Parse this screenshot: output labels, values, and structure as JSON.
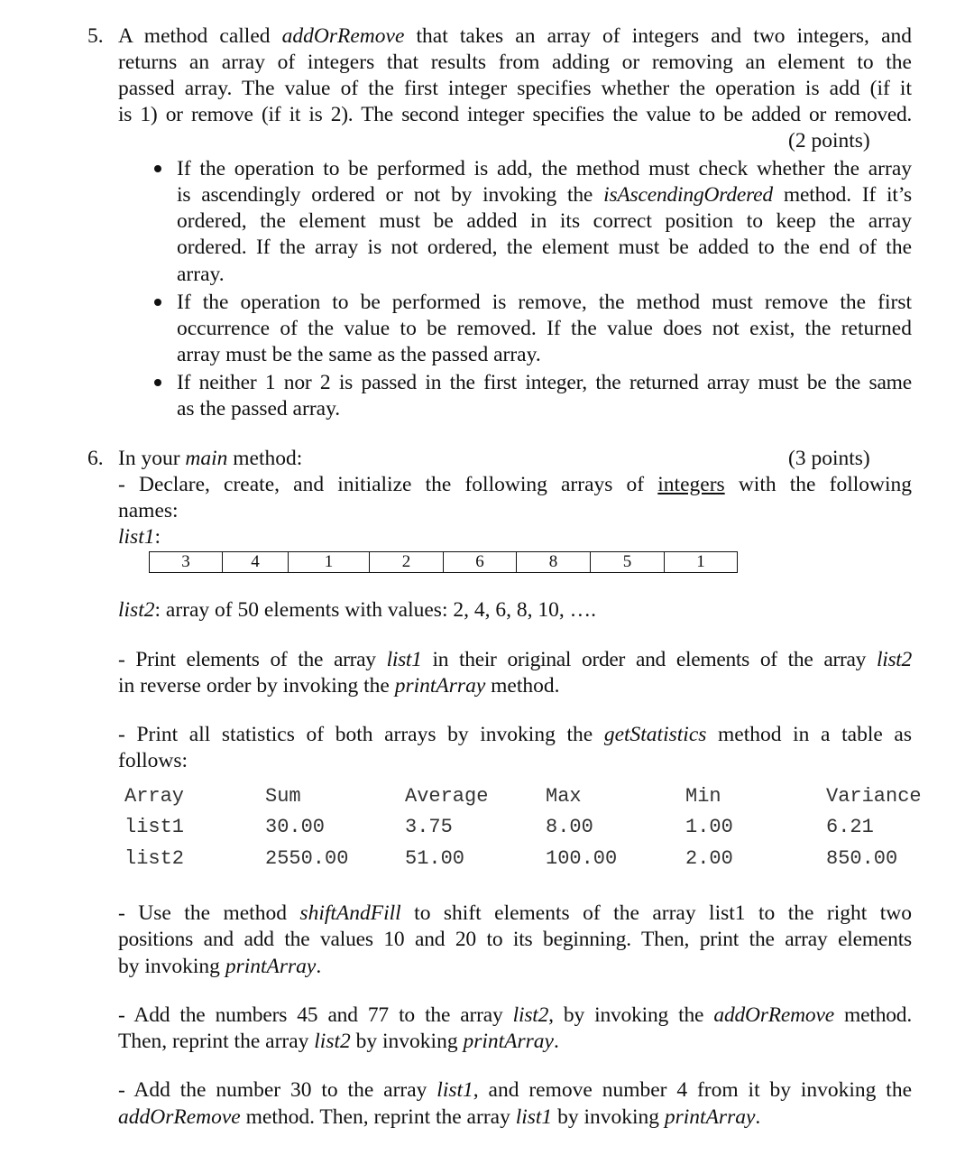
{
  "q5": {
    "number": "5.",
    "lines": [
      [
        "A method called ",
        "addOrRemove",
        " that takes an array of integers and two integers, and"
      ],
      "returns an array of integers that results from adding or removing an element to the",
      "passed array. The value of the first integer specifies whether the operation is add (if it",
      "is 1) or remove (if it is 2). The second integer specifies the value to be added or removed."
    ],
    "l1a": "A method called ",
    "l1b": "addOrRemove",
    "l1c": " that takes an array of integers and two integers, and",
    "l2": "returns an array of integers that results from adding or removing an element to the",
    "l3": "passed array. The value of the first integer specifies whether the operation is add (if it",
    "l4": "is 1) or remove (if it is 2). The second integer specifies the value to be added or removed.",
    "points": "(2 points)",
    "bullets": {
      "b1": {
        "l1": "If the operation to be performed is add, the method must check whether the array",
        "l2a": "is ascendingly ordered or not by invoking the ",
        "l2b": "isAscendingOrdered",
        "l2c": " method. If it’s",
        "l3": "ordered, the element must be added in its correct position to keep the array",
        "l4": "ordered. If the array is not ordered, the element must be added to the end of the",
        "l5": "array."
      },
      "b2": {
        "l1": "If the operation to be performed is remove, the method must remove the first",
        "l2": "occurrence of the value to be removed. If the value does not exist, the returned",
        "l3": "array must be the same as the passed array."
      },
      "b3": {
        "l1": "If neither 1 nor 2 is passed in the first integer, the returned array must be the same",
        "l2": "as the passed array."
      }
    }
  },
  "q6": {
    "number": "6.",
    "intro_a": "In your ",
    "intro_b": "main",
    "intro_c": " method:",
    "points": "(3 points)",
    "declare_a": "- Declare, create, and initialize the following arrays of ",
    "declare_b": "integers",
    "declare_c": " with the following",
    "declare_d": "names:",
    "list1_label": "list1",
    "list1_colon": ":",
    "list1_values": [
      "3",
      "4",
      "1",
      "2",
      "6",
      "8",
      "5",
      "1"
    ],
    "list2_label": "list2",
    "list2_text": ": array of 50 elements with values: 2, 4, 6, 8, 10, ….",
    "print": {
      "l1a": "- Print elements of the array ",
      "l1b": "list1",
      "l1c": " in their original order and elements of the array ",
      "l1d": "list2",
      "l2a": "in reverse order by invoking the ",
      "l2b": "printArray",
      "l2c": " method."
    },
    "stats": {
      "l1a": "- Print all statistics of both arrays by invoking the ",
      "l1b": "getStatistics",
      "l1c": " method in a table as",
      "l2": "follows:"
    },
    "stats_table": {
      "headers": [
        "Array",
        "Sum",
        "Average",
        "Max",
        "Min",
        "Variance"
      ],
      "rows": [
        [
          "list1",
          "30.00",
          "3.75",
          "8.00",
          "1.00",
          "6.21"
        ],
        [
          "list2",
          "2550.00",
          "51.00",
          "100.00",
          "2.00",
          "850.00"
        ]
      ]
    },
    "shift": {
      "l1a": "- Use the method ",
      "l1b": "shiftAndFill",
      "l1c": " to shift elements of the array list1 to the right two",
      "l2": "positions and add the values 10 and 20 to its beginning. Then, print the array elements",
      "l3a": "by invoking ",
      "l3b": "printArray",
      "l3c": "."
    },
    "add45": {
      "l1a": "- Add the numbers 45 and 77 to the array ",
      "l1b": "list2",
      "l1c": ", by invoking the ",
      "l1d": "addOrRemove",
      "l1e": " method.",
      "l2a": "Then, reprint the array ",
      "l2b": "list2",
      "l2c": " by invoking ",
      "l2d": "printArray",
      "l2e": "."
    },
    "add30": {
      "l1a": "- Add the number 30 to the array ",
      "l1b": "list1",
      "l1c": ", and remove number 4 from it by invoking the",
      "l2a": "addOrRemove",
      "l2b": " method. Then, reprint the array ",
      "l2c": "list1",
      "l2d": " by invoking ",
      "l2e": "printArray",
      "l2f": "."
    }
  }
}
